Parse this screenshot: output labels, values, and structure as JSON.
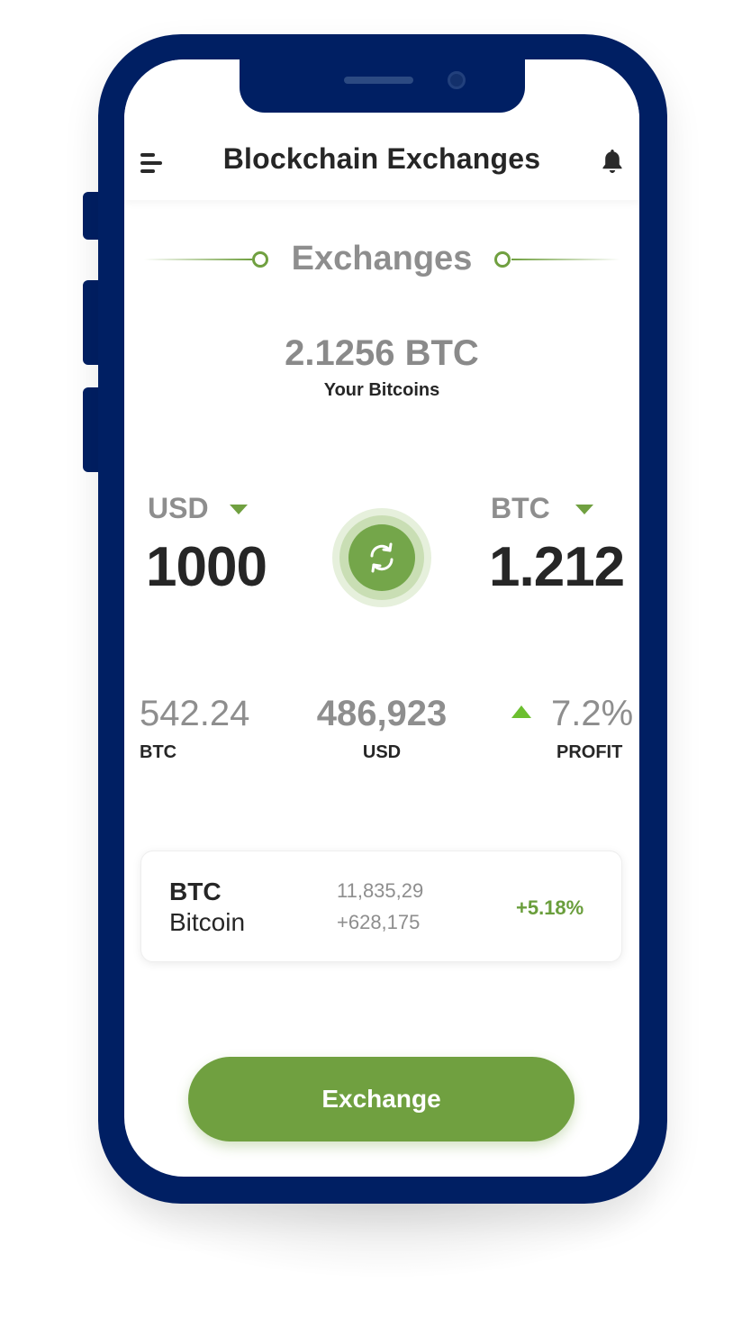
{
  "header": {
    "title": "Blockchain Exchanges",
    "menu_icon": "hamburger-menu-icon",
    "notification_icon": "bell-icon"
  },
  "section": {
    "title": "Exchanges"
  },
  "balance": {
    "amount": "2.1256 BTC",
    "label": "Your Bitcoins"
  },
  "converter": {
    "from_currency": "USD",
    "from_value": "1000",
    "to_currency": "BTC",
    "to_value": "1.212",
    "swap_icon": "swap-arrows-icon"
  },
  "stats": [
    {
      "value": "542.24",
      "label": "BTC"
    },
    {
      "value": "486,923",
      "label": "USD"
    },
    {
      "value": "7.2%",
      "label": "PROFIT",
      "trend": "up"
    }
  ],
  "market_card": {
    "symbol": "BTC",
    "name": "Bitcoin",
    "price": "11,835,29",
    "volume": "+628,175",
    "change": "+5.18%"
  },
  "action": {
    "exchange_label": "Exchange"
  },
  "colors": {
    "frame": "#001f63",
    "accent": "#70a040",
    "profit_up": "#6cbf2f",
    "text_dark": "#262626",
    "text_muted": "#8e8e8e"
  }
}
